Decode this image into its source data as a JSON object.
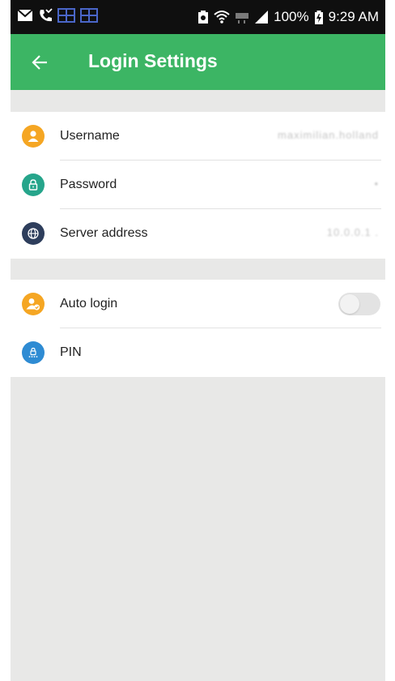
{
  "status_bar": {
    "left_icons": [
      "mail-icon",
      "missed-call-icon",
      "app-notification-icon",
      "app-notification-icon"
    ],
    "battery_percent": "100%",
    "time": "9:29 AM",
    "right_icons": [
      "battery-saver-icon",
      "wifi-icon",
      "lte-icon",
      "signal-icon",
      "battery-icon"
    ]
  },
  "app_bar": {
    "title": "Login Settings",
    "back_icon": "arrow-left-icon",
    "color": "#3cb564"
  },
  "account_section": {
    "items": [
      {
        "label": "Username",
        "value": "maximilian.holland",
        "icon": "user-icon",
        "icon_color": "#f5a623"
      },
      {
        "label": "Password",
        "value": "•",
        "icon": "lock-icon",
        "icon_color": "#26a58b"
      },
      {
        "label": "Server address",
        "value": "10.0.0.1   .",
        "icon": "globe-icon",
        "icon_color": "#2e3e5c"
      }
    ]
  },
  "login_section": {
    "items": [
      {
        "label": "Auto login",
        "icon": "auto-login-user-icon",
        "icon_color": "#f5a623",
        "toggle_on": false
      },
      {
        "label": "PIN",
        "icon": "pin-lock-icon",
        "icon_color": "#2e8bd3"
      }
    ]
  }
}
